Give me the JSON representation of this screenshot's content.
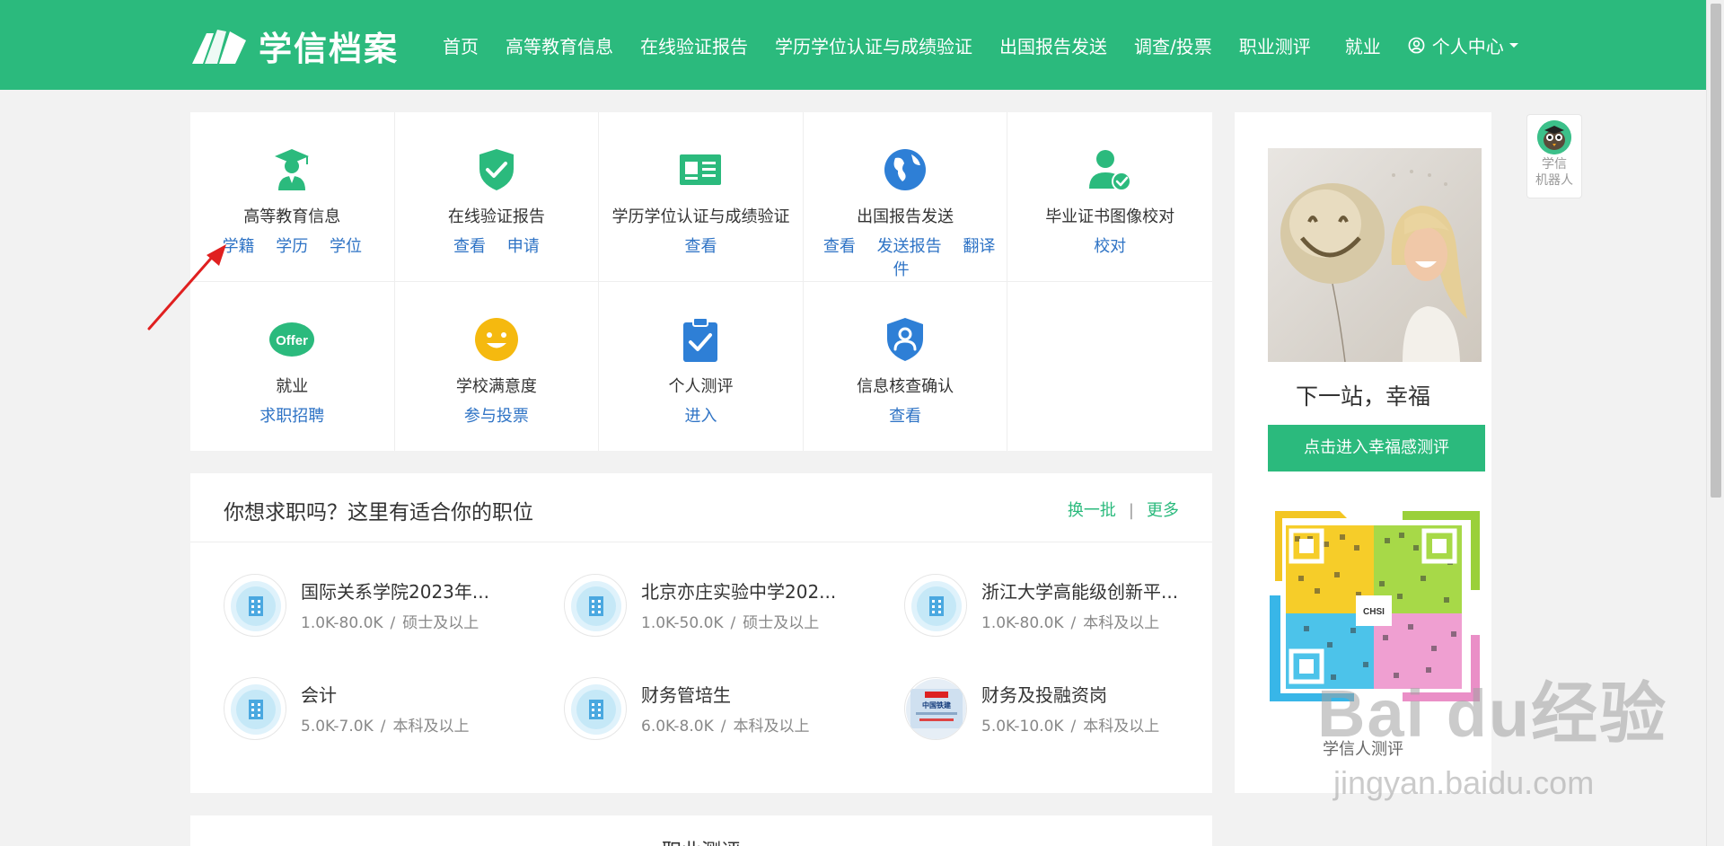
{
  "brand": {
    "name": "学信档案",
    "color": "#2bba7d",
    "link_color": "#2e73c5"
  },
  "nav": {
    "items": [
      "首页",
      "高等教育信息",
      "在线验证报告",
      "学历学位认证与成绩验证",
      "出国报告发送",
      "调查/投票",
      "职业测评",
      "就业"
    ],
    "user_label": "个人中心"
  },
  "services": [
    {
      "name": "高等教育信息",
      "icon": "graduate-icon",
      "links": [
        "学籍",
        "学历",
        "学位"
      ]
    },
    {
      "name": "在线验证报告",
      "icon": "shield-check-icon",
      "links": [
        "查看",
        "申请"
      ]
    },
    {
      "name": "学历学位认证与成绩验证",
      "icon": "id-card-icon",
      "links": [
        "查看"
      ]
    },
    {
      "name": "出国报告发送",
      "icon": "globe-icon",
      "links": [
        "查看",
        "发送报告",
        "翻译件"
      ]
    },
    {
      "name": "毕业证书图像校对",
      "icon": "user-check-icon",
      "links": [
        "校对"
      ]
    },
    {
      "name": "就业",
      "icon": "offer-icon",
      "links": [
        "求职招聘"
      ]
    },
    {
      "name": "学校满意度",
      "icon": "smiley-icon",
      "links": [
        "参与投票"
      ]
    },
    {
      "name": "个人测评",
      "icon": "clipboard-check-icon",
      "links": [
        "进入"
      ]
    },
    {
      "name": "信息核查确认",
      "icon": "shield-user-icon",
      "links": [
        "查看"
      ]
    }
  ],
  "jobs": {
    "title": "你想求职吗？这里有适合你的职位",
    "refresh_label": "换一批",
    "more_label": "更多",
    "items": [
      {
        "title": "国际关系学院2023年...",
        "salary": "1.0K-80.0K",
        "degree": "硕士及以上"
      },
      {
        "title": "北京亦庄实验中学202...",
        "salary": "1.0K-50.0K",
        "degree": "硕士及以上"
      },
      {
        "title": "浙江大学高能级创新平...",
        "salary": "1.0K-80.0K",
        "degree": "本科及以上"
      },
      {
        "title": "会计",
        "salary": "5.0K-7.0K",
        "degree": "本科及以上"
      },
      {
        "title": "财务管培生",
        "salary": "6.0K-8.0K",
        "degree": "本科及以上"
      },
      {
        "title": "财务及投融资岗",
        "salary": "5.0K-10.0K",
        "degree": "本科及以上"
      }
    ],
    "logo_text": "中国铁建"
  },
  "bottom_section": {
    "title": "职业测评"
  },
  "side": {
    "caption": "下一站，幸福",
    "button_label": "点击进入幸福感测评",
    "qr_center_text": "CHSI",
    "qr_label": "学信人测评"
  },
  "robot": {
    "line1": "学信",
    "line2": "机器人"
  },
  "watermark": {
    "main": "Bai du经验",
    "sub": "jingyan.baidu.com"
  }
}
